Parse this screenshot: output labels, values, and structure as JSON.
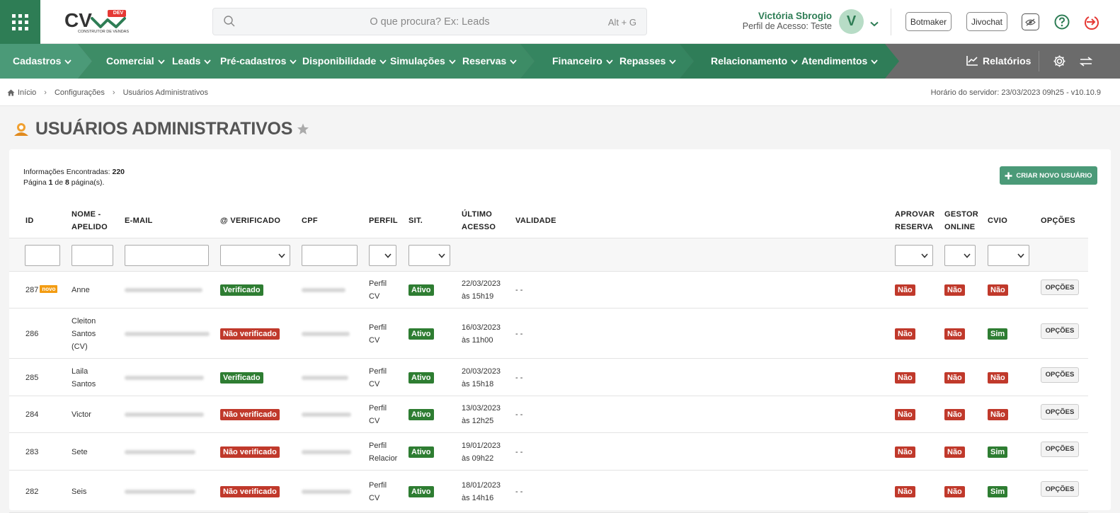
{
  "search": {
    "placeholder": "O que procura? Ex: Leads",
    "shortcut": "Alt + G"
  },
  "logo": {
    "tag": "DEV",
    "subtitle": "CONSTRUTOR DE VENDAS"
  },
  "user": {
    "name": "Victória Sbrogio",
    "profile": "Perfil de Acesso: Teste",
    "initial": "V"
  },
  "header_buttons": {
    "botmaker": "Botmaker",
    "jivochat": "Jivochat"
  },
  "nav": {
    "items": [
      "Cadastros",
      "Comercial",
      "Leads",
      "Pré-cadastros",
      "Disponibilidade",
      "Simulações",
      "Reservas",
      "Financeiro",
      "Repasses",
      "Relacionamento",
      "Atendimentos"
    ],
    "reports": "Relatórios",
    "colors": [
      "#4b9a78",
      "#3d8c66",
      "#358560",
      "#2f7d58"
    ]
  },
  "breadcrumb": [
    "Início",
    "Configurações",
    "Usuários Administrativos"
  ],
  "server_time": "Horário do servidor: 23/03/2023 09h25 - v10.10.9",
  "page_title": "USUÁRIOS ADMINISTRATIVOS",
  "summary": {
    "found_label": "Informações Encontradas:",
    "found_count": "220",
    "page_label": "Página",
    "page": "1",
    "of": "de",
    "total_pages": "8",
    "pages_suffix": "página(s)."
  },
  "create_button": "CRIAR NOVO USUÁRIO",
  "columns": {
    "id": "ID",
    "name_1": "NOME -",
    "name_2": "APELIDO",
    "email": "E-MAIL",
    "verified": "@ VERIFICADO",
    "cpf": "CPF",
    "profile": "PERFIL",
    "status": "SIT.",
    "last_1": "ÚLTIMO",
    "last_2": "ACESSO",
    "validity": "VALIDADE",
    "approve_1": "APROVAR",
    "approve_2": "RESERVA",
    "manager_1": "GESTOR",
    "manager_2": "ONLINE",
    "cvio": "CVIO",
    "options": "OPÇÕES"
  },
  "rows": [
    {
      "id": "287",
      "new_badge": "novo",
      "name": [
        "Anne"
      ],
      "verified": "Verificado",
      "verified_ok": true,
      "profile": [
        "Perfil",
        "CV"
      ],
      "status": "Ativo",
      "last_access": [
        "22/03/2023",
        "às 15h19"
      ],
      "validity": "- -",
      "approve": "Não",
      "manager": "Não",
      "cvio": "Não",
      "options": "OPÇÕES"
    },
    {
      "id": "286",
      "name": [
        "Cleiton",
        "Santos",
        "(CV)"
      ],
      "verified": "Não verificado",
      "verified_ok": false,
      "profile": [
        "Perfil",
        "CV"
      ],
      "status": "Ativo",
      "last_access": [
        "16/03/2023",
        "às 11h00"
      ],
      "validity": "- -",
      "approve": "Não",
      "manager": "Não",
      "cvio": "Sim",
      "options": "OPÇÕES"
    },
    {
      "id": "285",
      "name": [
        "Laila",
        "Santos"
      ],
      "verified": "Verificado",
      "verified_ok": true,
      "profile": [
        "Perfil",
        "CV"
      ],
      "status": "Ativo",
      "last_access": [
        "20/03/2023",
        "às 15h18"
      ],
      "validity": "- -",
      "approve": "Não",
      "manager": "Não",
      "cvio": "Não",
      "options": "OPÇÕES"
    },
    {
      "id": "284",
      "name": [
        "Victor"
      ],
      "verified": "Não verificado",
      "verified_ok": false,
      "profile": [
        "Perfil",
        "CV"
      ],
      "status": "Ativo",
      "last_access": [
        "13/03/2023",
        "às 12h25"
      ],
      "validity": "- -",
      "approve": "Não",
      "manager": "Não",
      "cvio": "Não",
      "options": "OPÇÕES"
    },
    {
      "id": "283",
      "name": [
        "Sete"
      ],
      "verified": "Não verificado",
      "verified_ok": false,
      "profile": [
        "Perfil",
        "Relacior"
      ],
      "status": "Ativo",
      "last_access": [
        "19/01/2023",
        "às 09h22"
      ],
      "validity": "- -",
      "approve": "Não",
      "manager": "Não",
      "cvio": "Sim",
      "options": "OPÇÕES"
    },
    {
      "id": "282",
      "name": [
        "Seis"
      ],
      "verified": "Não verificado",
      "verified_ok": false,
      "profile": [
        "Perfil",
        "CV"
      ],
      "status": "Ativo",
      "last_access": [
        "18/01/2023",
        "às 14h16"
      ],
      "validity": "- -",
      "approve": "Não",
      "manager": "Não",
      "cvio": "Sim",
      "options": "OPÇÕES"
    }
  ]
}
